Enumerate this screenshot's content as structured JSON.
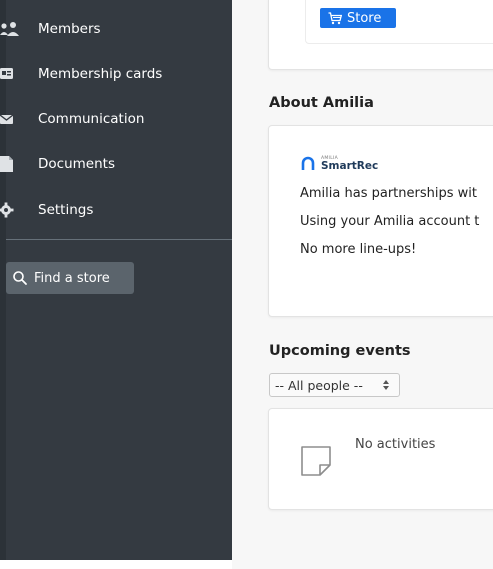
{
  "sidebar": {
    "items": [
      {
        "label": "Members",
        "icon": "members-icon"
      },
      {
        "label": "Membership cards",
        "icon": "membership-card-icon"
      },
      {
        "label": "Communication",
        "icon": "envelope-icon"
      },
      {
        "label": "Documents",
        "icon": "document-icon"
      },
      {
        "label": "Settings",
        "icon": "gear-icon"
      }
    ],
    "find_store": {
      "label": "Find a store",
      "icon": "search-icon"
    }
  },
  "main": {
    "store_button": {
      "label": "Store",
      "icon": "cart-icon"
    },
    "about": {
      "title": "About Amilia",
      "logo_small": "AMILIA",
      "logo_text": "SmartRec",
      "paragraphs": [
        "Amilia has partnerships wit",
        "Using your Amilia account t",
        "No more line-ups!"
      ]
    },
    "events": {
      "title": "Upcoming events",
      "filter_selected": "-- All people --",
      "empty_text": "No activities",
      "empty_icon": "sticky-note-icon"
    }
  },
  "colors": {
    "sidebar_bg": "#343a41",
    "accent": "#1a73e8",
    "find_store_bg": "#5b646c"
  }
}
